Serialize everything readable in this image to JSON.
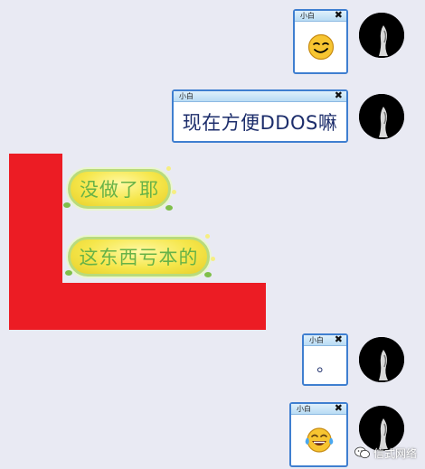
{
  "colors": {
    "background": "#e9eaf3",
    "window_border": "#3f7fd0",
    "redaction": "#ec1c24",
    "bubble_text": "#67b247",
    "message_text": "#1c2d6b"
  },
  "messages_right": [
    {
      "sender": "小白",
      "close": "✖",
      "type": "emoji",
      "emoji_icon": "smirk-face-icon"
    },
    {
      "sender": "小白",
      "close": "✖",
      "type": "text",
      "text": "现在方便DDOS嘛"
    },
    {
      "sender": "小白",
      "close": "✖",
      "type": "text",
      "text": "。"
    },
    {
      "sender": "小白",
      "close": "✖",
      "type": "emoji",
      "emoji_icon": "tears-of-joy-icon"
    }
  ],
  "messages_left": [
    {
      "text": "没做了耶"
    },
    {
      "text": "这东西亏本的"
    }
  ],
  "watermark": {
    "icon": "wechat-icon",
    "text": "信式网络"
  }
}
